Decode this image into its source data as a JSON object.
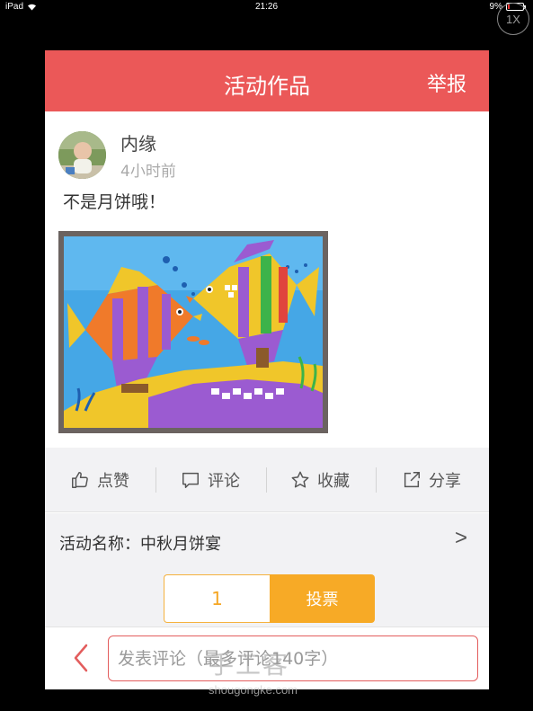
{
  "status_bar": {
    "device": "iPad",
    "time": "21:26",
    "battery_percent": "9%"
  },
  "zoom_badge": "1X",
  "header": {
    "title": "活动作品",
    "report_label": "举报",
    "background_color": "#eb5858"
  },
  "post": {
    "username": "内缘",
    "time_ago": "4小时前",
    "text": "不是月饼哦！"
  },
  "actions": [
    {
      "label": "点赞",
      "icon": "thumbs-up-icon"
    },
    {
      "label": "评论",
      "icon": "comment-icon"
    },
    {
      "label": "收藏",
      "icon": "star-icon"
    },
    {
      "label": "分享",
      "icon": "share-icon"
    }
  ],
  "activity": {
    "label": "活动名称：中秋月饼宴",
    "chevron": ">"
  },
  "vote": {
    "count": "1",
    "button_label": "投票",
    "accent_color": "#f7aa26"
  },
  "comment": {
    "placeholder": "发表评论（最多评论140字）"
  },
  "watermark": {
    "brand": "手工客",
    "domain": "shougongke.com"
  }
}
